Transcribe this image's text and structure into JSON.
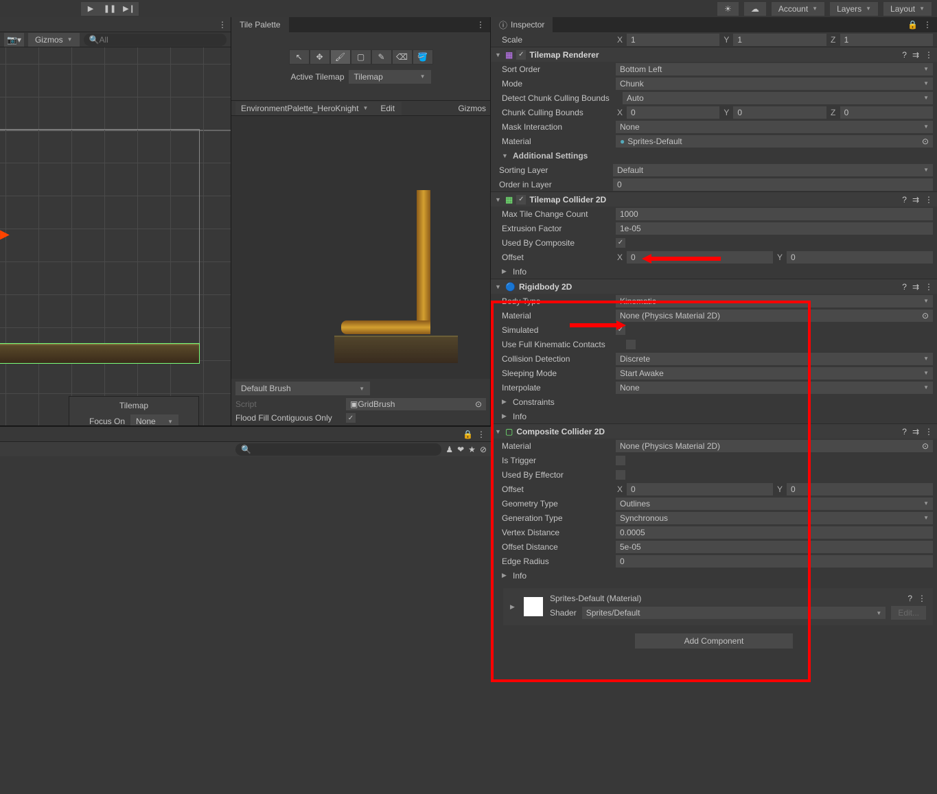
{
  "topbar": {
    "account": "Account",
    "layers": "Layers",
    "layout": "Layout"
  },
  "scene": {
    "gizmos": "Gizmos",
    "search_placeholder": "All",
    "focus_title": "Tilemap",
    "focus_label": "Focus On",
    "focus_value": "None"
  },
  "palette": {
    "tab": "Tile Palette",
    "active_label": "Active Tilemap",
    "active_value": "Tilemap",
    "palette_name": "EnvironmentPalette_HeroKnight",
    "edit": "Edit",
    "gizmos": "Gizmos",
    "brush": "Default Brush",
    "script_label": "Script",
    "script_value": "GridBrush",
    "flood_label": "Flood Fill Contiguous Only"
  },
  "inspector": {
    "tab": "Inspector",
    "scale": {
      "label": "Scale",
      "x": "1",
      "y": "1",
      "z": "1"
    },
    "tilemap_renderer": {
      "title": "Tilemap Renderer",
      "sort_order": {
        "label": "Sort Order",
        "value": "Bottom Left"
      },
      "mode": {
        "label": "Mode",
        "value": "Chunk"
      },
      "detect": {
        "label": "Detect Chunk Culling Bounds",
        "value": "Auto"
      },
      "culling": {
        "label": "Chunk Culling Bounds",
        "x": "0",
        "y": "0",
        "z": "0"
      },
      "mask": {
        "label": "Mask Interaction",
        "value": "None"
      },
      "material": {
        "label": "Material",
        "value": "Sprites-Default"
      },
      "additional": "Additional Settings",
      "sorting_layer": {
        "label": "Sorting Layer",
        "value": "Default"
      },
      "order": {
        "label": "Order in Layer",
        "value": "0"
      }
    },
    "tilemap_collider": {
      "title": "Tilemap Collider 2D",
      "max_tile": {
        "label": "Max Tile Change Count",
        "value": "1000"
      },
      "extrusion": {
        "label": "Extrusion Factor",
        "value": "1e-05"
      },
      "composite": {
        "label": "Used By Composite",
        "checked": true
      },
      "offset": {
        "label": "Offset",
        "x": "0",
        "y": "0"
      },
      "info": "Info"
    },
    "rigidbody": {
      "title": "Rigidbody 2D",
      "body_type": {
        "label": "Body Type",
        "value": "Kinematic"
      },
      "material": {
        "label": "Material",
        "value": "None (Physics Material 2D)"
      },
      "simulated": {
        "label": "Simulated",
        "checked": true
      },
      "kinematic_contacts": {
        "label": "Use Full Kinematic Contacts",
        "checked": false
      },
      "collision": {
        "label": "Collision Detection",
        "value": "Discrete"
      },
      "sleeping": {
        "label": "Sleeping Mode",
        "value": "Start Awake"
      },
      "interpolate": {
        "label": "Interpolate",
        "value": "None"
      },
      "constraints": "Constraints",
      "info": "Info"
    },
    "composite_collider": {
      "title": "Composite Collider 2D",
      "material": {
        "label": "Material",
        "value": "None (Physics Material 2D)"
      },
      "is_trigger": {
        "label": "Is Trigger",
        "checked": false
      },
      "effector": {
        "label": "Used By Effector",
        "checked": false
      },
      "offset": {
        "label": "Offset",
        "x": "0",
        "y": "0"
      },
      "geometry": {
        "label": "Geometry Type",
        "value": "Outlines"
      },
      "generation": {
        "label": "Generation Type",
        "value": "Synchronous"
      },
      "vertex": {
        "label": "Vertex Distance",
        "value": "0.0005"
      },
      "offset_dist": {
        "label": "Offset Distance",
        "value": "5e-05"
      },
      "edge": {
        "label": "Edge Radius",
        "value": "0"
      },
      "info": "Info"
    },
    "material_block": {
      "title": "Sprites-Default (Material)",
      "shader_label": "Shader",
      "shader_value": "Sprites/Default",
      "edit": "Edit..."
    },
    "add_component": "Add Component"
  }
}
